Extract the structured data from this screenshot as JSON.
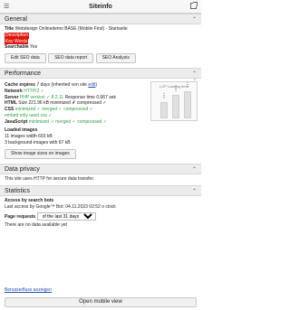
{
  "window": {
    "title": "Siteinfo"
  },
  "general": {
    "heading": "General",
    "title_label": "Title",
    "title_value": "Webdesign Onlinedemo BASE (Mobile First) - Startseite",
    "description": "Description",
    "keywords": "Key Words",
    "searchable_label": "Searchable",
    "searchable_value": "Yes",
    "buttons": [
      "Edit SEO data",
      "SEO data report",
      "SEO Analysis"
    ]
  },
  "performance": {
    "heading": "Performance",
    "help": "?",
    "cache_label": "Cache expires",
    "cache_value": "7 days (inherited von site",
    "cache_link": "edit",
    "network_label": "Network",
    "network_value": "HTTP/2 ✓",
    "server_label": "Server",
    "server_value": "PHP version ✓ 8.2.11",
    "response_label": "Response time",
    "response_value": "0.667 sek",
    "html_label": "HTML",
    "html_value": "Size 221.96 kB minimized ✗ compressed ✓",
    "css_label": "CSS",
    "css_value": "minimized ✓ merged ✓ compressed ✓",
    "css_embed": "embed only used css ✓",
    "js_label": "JavaScript",
    "js_value": "minimized ✓ merged ✓ compressed ✓",
    "images_heading": "Loaded images",
    "images_line1": "11 images width 693 kB",
    "images_line2": "3 background-images with 67 kB",
    "images_button": "Show image sizes on images",
    "chart": {
      "title": "LCP Loading time",
      "bars": [
        {
          "label": "2.6 s",
          "value": 2.6
        },
        {
          "label": "3.8 s",
          "value": 3.8
        },
        {
          "label": "4.4 s",
          "value": 4.4
        }
      ]
    }
  },
  "privacy": {
    "heading": "Data privacy",
    "text": "This site uses HTTP for secure data transfer."
  },
  "statistics": {
    "heading": "Statistics",
    "access_heading": "Access by search bots",
    "last_access": "Last access by Google™ Bot: 04.11.2023 02:52 o clock",
    "page_requests_label": "Page requests",
    "period_selected": "of the last 31 days",
    "no_data": "There are no data available yet"
  },
  "footer": {
    "flow_link": "Benutzerfluss anzeigen",
    "mobile_button": "Open mobile view"
  }
}
